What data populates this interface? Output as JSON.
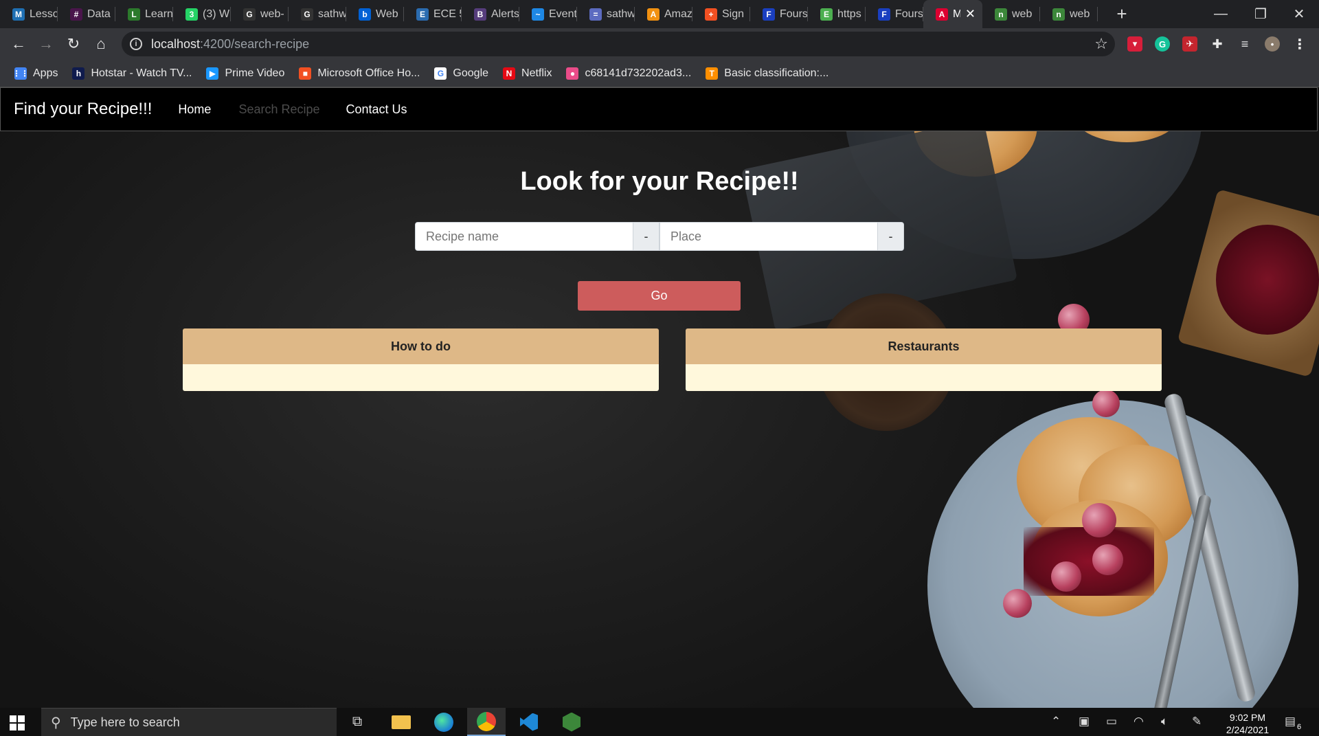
{
  "tabs": [
    {
      "title": "Lesso",
      "icon": "m-icon",
      "color": "#1f6fb2",
      "glyph": "M"
    },
    {
      "title": "Data",
      "icon": "slack-icon",
      "color": "#4a154b",
      "glyph": "#"
    },
    {
      "title": "Learn",
      "icon": "leaf-icon",
      "color": "#2c7a2c",
      "glyph": "L"
    },
    {
      "title": "(3) W",
      "icon": "whatsapp-icon",
      "color": "#25d366",
      "glyph": "3"
    },
    {
      "title": "web-",
      "icon": "github-icon",
      "color": "#333333",
      "glyph": "G"
    },
    {
      "title": "sathw",
      "icon": "github-icon",
      "color": "#333333",
      "glyph": "G"
    },
    {
      "title": "Web",
      "icon": "box-icon",
      "color": "#0061d5",
      "glyph": "b"
    },
    {
      "title": "ECE 5",
      "icon": "course-icon",
      "color": "#2b6cb0",
      "glyph": "E"
    },
    {
      "title": "Alerts",
      "icon": "bootstrap-icon",
      "color": "#563d7c",
      "glyph": "B"
    },
    {
      "title": "Event",
      "icon": "wave-icon",
      "color": "#1e88e5",
      "glyph": "~"
    },
    {
      "title": "sathw",
      "icon": "board-icon",
      "color": "#5c6bc0",
      "glyph": "="
    },
    {
      "title": "Amaz",
      "icon": "aws-icon",
      "color": "#f29111",
      "glyph": "A"
    },
    {
      "title": "Sign",
      "icon": "microsoft-icon",
      "color": "#f25022",
      "glyph": "+"
    },
    {
      "title": "Fours",
      "icon": "f-icon",
      "color": "#1a3fc0",
      "glyph": "F"
    },
    {
      "title": "https",
      "icon": "e-icon",
      "color": "#4caf50",
      "glyph": "E"
    },
    {
      "title": "Fours",
      "icon": "f-icon",
      "color": "#1a3fc0",
      "glyph": "F"
    },
    {
      "title": "M",
      "icon": "angular-icon",
      "color": "#dd0031",
      "glyph": "A",
      "active": true
    },
    {
      "title": "web",
      "icon": "node-icon",
      "color": "#3c873a",
      "glyph": "n"
    },
    {
      "title": "web",
      "icon": "node-icon",
      "color": "#3c873a",
      "glyph": "n"
    }
  ],
  "address": {
    "host": "localhost",
    "path": ":4200/search-recipe"
  },
  "bookmarks": [
    {
      "label": "Apps",
      "icon": "apps-grid-icon",
      "color": "#4285f4",
      "glyph": "⋮⋮"
    },
    {
      "label": "Hotstar - Watch TV...",
      "icon": "hotstar-icon",
      "color": "#0f1b4d",
      "glyph": "h"
    },
    {
      "label": "Prime Video",
      "icon": "prime-video-icon",
      "color": "#1a98ff",
      "glyph": "▶"
    },
    {
      "label": "Microsoft Office Ho...",
      "icon": "office-icon",
      "color": "#f25022",
      "glyph": "■"
    },
    {
      "label": "Google",
      "icon": "google-icon",
      "color": "#ffffff",
      "glyph": "G"
    },
    {
      "label": "Netflix",
      "icon": "netflix-icon",
      "color": "#e50914",
      "glyph": "N"
    },
    {
      "label": "c68141d732202ad3...",
      "icon": "dribbble-icon",
      "color": "#ea4c89",
      "glyph": "●"
    },
    {
      "label": "Basic classification:...",
      "icon": "tensorflow-icon",
      "color": "#ff8f00",
      "glyph": "T"
    }
  ],
  "navbar": {
    "brand": "Find your Recipe!!!",
    "links": [
      "Home",
      "Search Recipe",
      "Contact Us"
    ]
  },
  "main": {
    "heading": "Look for your Recipe!!",
    "recipe_placeholder": "Recipe name",
    "recipe_addon": "-",
    "place_placeholder": "Place",
    "place_addon": "-",
    "go_label": "Go",
    "cards": [
      "How to do",
      "Restaurants"
    ]
  },
  "colors": {
    "card_header": "#deb887",
    "card_body": "#fff8dc",
    "go_button": "#cd5c5c",
    "navbar": "#000000"
  },
  "taskbar": {
    "search_placeholder": "Type here to search",
    "time": "9:02 PM",
    "date": "2/24/2021",
    "notifications": "6"
  }
}
